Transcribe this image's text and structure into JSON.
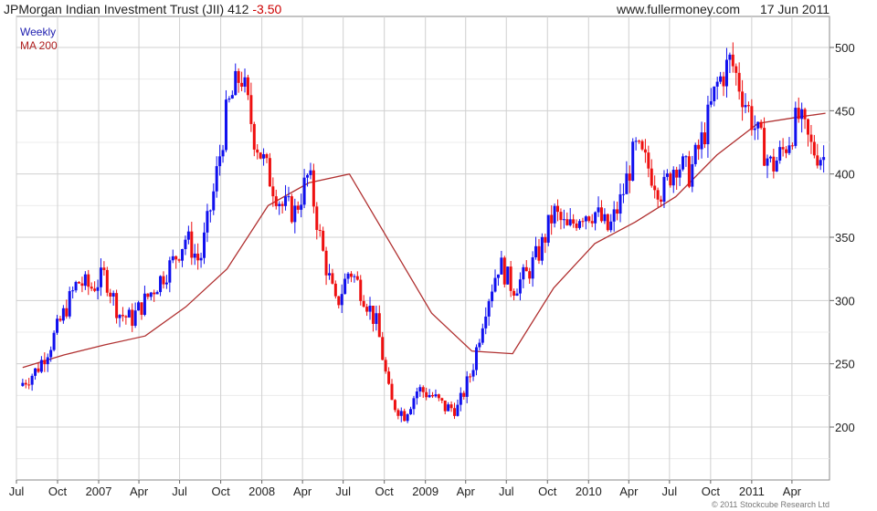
{
  "header": {
    "title": "JPMorgan Indian Investment Trust (JII) 412",
    "change": "-3.50",
    "website": "www.fullermoney.com",
    "date": "17 Jun 2011"
  },
  "legend": {
    "weekly": "Weekly",
    "ma": "MA 200"
  },
  "copyright": "© 2011 Stockcube Research Ltd",
  "colors": {
    "up": "#1010ee",
    "down": "#ee1010",
    "ma": "#b03030",
    "grid": "#d0d0d0"
  },
  "chart_data": {
    "type": "line",
    "title": "JPMorgan Indian Investment Trust (JII)",
    "x_tick_labels": [
      "Jul",
      "Oct",
      "2007",
      "Apr",
      "Jul",
      "Oct",
      "2008",
      "Apr",
      "Jul",
      "Oct",
      "2009",
      "Apr",
      "Jul",
      "Oct",
      "2010",
      "Apr",
      "Jul",
      "Oct",
      "2011",
      "Apr"
    ],
    "y_ticks": [
      200,
      250,
      300,
      350,
      400,
      450,
      500
    ],
    "ylim": [
      160,
      510
    ],
    "grid": true,
    "y_axis_side": "right",
    "series": [
      {
        "name": "Weekly",
        "style": "candlestick",
        "x": [
          "2006-07",
          "2006-08",
          "2006-09",
          "2006-10",
          "2006-11",
          "2006-12",
          "2007-01",
          "2007-02",
          "2007-03",
          "2007-04",
          "2007-05",
          "2007-06",
          "2007-07",
          "2007-08",
          "2007-09",
          "2007-10",
          "2007-11",
          "2007-12",
          "2008-01",
          "2008-02",
          "2008-03",
          "2008-04",
          "2008-05",
          "2008-06",
          "2008-07",
          "2008-08",
          "2008-09",
          "2008-10",
          "2008-11",
          "2008-12",
          "2009-01",
          "2009-02",
          "2009-03",
          "2009-04",
          "2009-05",
          "2009-06",
          "2009-07",
          "2009-08",
          "2009-09",
          "2009-10",
          "2009-11",
          "2009-12",
          "2010-01",
          "2010-02",
          "2010-03",
          "2010-04",
          "2010-05",
          "2010-06",
          "2010-07",
          "2010-08",
          "2010-09",
          "2010-10",
          "2010-11",
          "2010-12",
          "2011-01",
          "2011-02",
          "2011-03",
          "2011-04",
          "2011-05",
          "2011-06"
        ],
        "values": [
          235,
          245,
          265,
          290,
          315,
          310,
          320,
          290,
          285,
          300,
          315,
          330,
          350,
          330,
          385,
          450,
          480,
          430,
          400,
          375,
          370,
          400,
          340,
          295,
          325,
          305,
          280,
          220,
          210,
          230,
          225,
          215,
          215,
          245,
          295,
          330,
          310,
          320,
          340,
          370,
          355,
          370,
          370,
          355,
          380,
          420,
          405,
          385,
          410,
          400,
          430,
          470,
          490,
          460,
          430,
          405,
          420,
          445,
          420,
          412
        ]
      },
      {
        "name": "MA 200",
        "style": "line",
        "x": [
          "2006-07",
          "2006-10",
          "2007-01",
          "2007-04",
          "2007-07",
          "2007-10",
          "2008-01",
          "2008-04",
          "2008-07",
          "2008-10",
          "2009-01",
          "2009-04",
          "2009-07",
          "2009-10",
          "2010-01",
          "2010-04",
          "2010-07",
          "2010-10",
          "2011-01",
          "2011-04",
          "2011-06"
        ],
        "values": [
          247,
          257,
          265,
          272,
          295,
          325,
          375,
          393,
          400,
          345,
          290,
          260,
          258,
          310,
          345,
          362,
          382,
          415,
          440,
          445,
          448
        ]
      }
    ]
  }
}
